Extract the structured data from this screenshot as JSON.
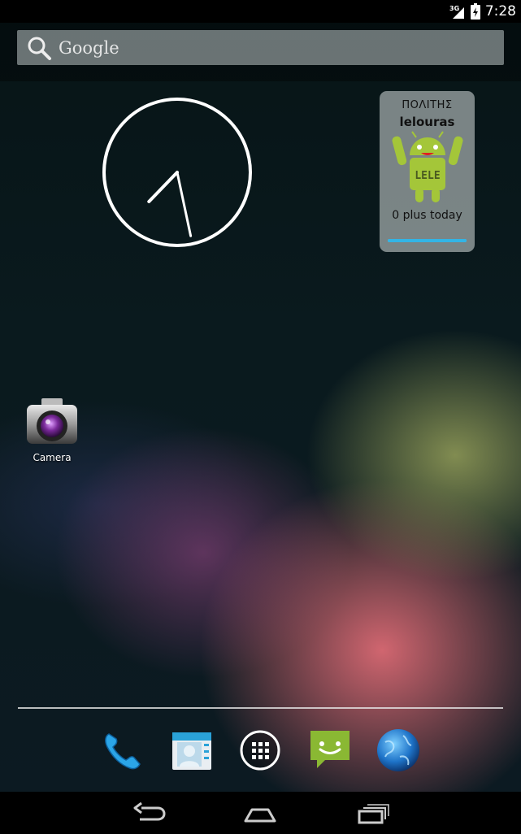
{
  "status_bar": {
    "network_label": "3G",
    "time": "7:28"
  },
  "search": {
    "placeholder": "Google"
  },
  "clock": {
    "hour": 7,
    "minute": 28
  },
  "plus_widget": {
    "title": "ΠΟΛΙΤΗΣ",
    "username": "lelouras",
    "robot_caption": "LELE",
    "count_text": "0 plus today",
    "progress": 1.0
  },
  "desktop_apps": [
    {
      "label": "Camera",
      "icon": "camera-icon"
    }
  ],
  "dock": [
    {
      "icon": "phone-icon"
    },
    {
      "icon": "contacts-icon"
    },
    {
      "icon": "all-apps-icon"
    },
    {
      "icon": "messaging-icon"
    },
    {
      "icon": "browser-icon"
    }
  ],
  "nav_bar": [
    {
      "icon": "back-icon"
    },
    {
      "icon": "home-icon"
    },
    {
      "icon": "recent-apps-icon"
    }
  ],
  "colors": {
    "accent": "#33b5e5",
    "android_green": "#a4c639"
  }
}
